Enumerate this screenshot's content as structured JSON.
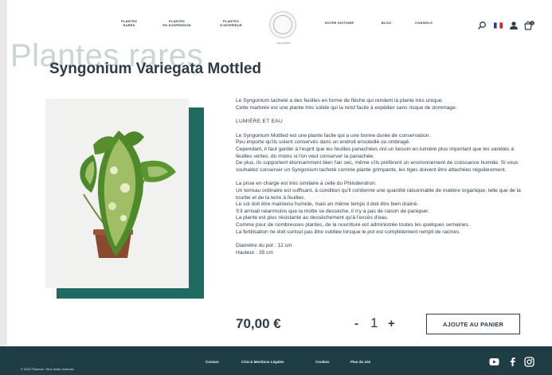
{
  "nav": {
    "left": [
      {
        "line1": "PLANTES",
        "line2": "RARES"
      },
      {
        "line1": "PLANTES",
        "line2": "EN SUSPENSION"
      },
      {
        "line1": "PLANTES",
        "line2": "D'INTERIEUR"
      }
    ],
    "right": [
      "NOTRE HISTOIRE",
      "BLOG",
      "CONSEILS"
    ],
    "logo_caption": "Depuis 2020",
    "cart_count": "0",
    "icons": [
      "search-icon",
      "flag-fr-icon",
      "user-icon",
      "cart-icon"
    ]
  },
  "category_title": "Plantes rares",
  "product": {
    "title": "Syngonium Variegata Mottled",
    "intro": [
      "Le Syngonium tacheté a des feuilles en forme de flèche qui rendent la plante très unique.",
      "Cette marbrée est une plante très solide qui la rend facile à expédier sans risque de dommage."
    ],
    "section_title": "LUMIÈRE ET EAU",
    "care1": [
      "Le Syngonium Mottled est une plante facile qui a une bonne durée de conservation.",
      "Peu importe qu'ils soient conservés dans un endroit ensoleillé ou ombragé.",
      "Cependant, il faut garder à l'esprit que les feuilles panachées ont un besoin en lumière plus important que les variétés à feuilles vertes, du moins si l'on veut conserver la panachée.",
      "De plus, ils supportent étonnamment bien l'air sec, même s'ils préfèrent un environnement de croissance humide. Si vous souhaitez conserver un Syngonium tacheté comme plante grimpante, les tiges doivent être attachées régulièrement."
    ],
    "care2": [
      "La prise en charge est très similaire à celle du Philodendron.",
      "Un terreau ordinaire est suffisant, à condition qu'il contienne une quantité raisonnable de matière organique, telle que de la tourbe et de la terre à feuilles.",
      "Le sol doit être maintenu humide, mais en même temps il doit être bien drainé.",
      "S'il arrivait néanmoins que la motte se dessèche, il n'y a pas de raison de paniquer.",
      "La plante est plus résistante au dessèchement qu'à l'excès d'eau.",
      "Comme pour de nombreuses plantes, de la nourriture est administrée toutes les quelques semaines.",
      "La fertilisation ne doit surtout pas être oubliée lorsque le pot est complètement rempli de racines."
    ],
    "pot_diameter": "Diamètre du pot : 12 cm",
    "height": "Hauteur : 35 cm",
    "price": "70,00 €",
    "qty_minus": "-",
    "quantity": "1",
    "qty_plus": "+",
    "add_to_cart": "AJOUTE AU PANIER"
  },
  "footer": {
    "copyright": "© 2022 Shumus. Tous droits réservés.",
    "links": [
      "Contact",
      "CGU & Mentions Légales",
      "Cookies",
      "Plan du site"
    ],
    "social": [
      "youtube-icon",
      "facebook-icon",
      "instagram-icon"
    ]
  },
  "colors": {
    "accent_teal": "#1f6b62",
    "footer_bg": "#1e3d44",
    "text_dark": "#2d3b4a",
    "bg_title": "#c9d6cd"
  }
}
